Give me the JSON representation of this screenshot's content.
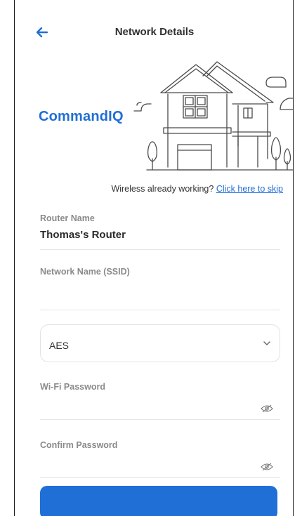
{
  "header": {
    "title": "Network Details",
    "back_icon": "arrow-left-icon"
  },
  "brand": {
    "name": "CommandIQ"
  },
  "colors": {
    "accent": "#1f6fd6",
    "label": "#8a8a8a",
    "divider": "#e6e6e6"
  },
  "skip": {
    "prompt": "Wireless already working?",
    "link_label": "Click here to skip"
  },
  "form": {
    "router_name": {
      "label": "Router Name",
      "value": "Thomas's Router"
    },
    "ssid": {
      "label": "Network Name (SSID)",
      "value": ""
    },
    "encryption": {
      "selected": "AES"
    },
    "wifi_password": {
      "label": "Wi-Fi Password",
      "value": ""
    },
    "confirm_password": {
      "label": "Confirm Password",
      "value": ""
    }
  }
}
